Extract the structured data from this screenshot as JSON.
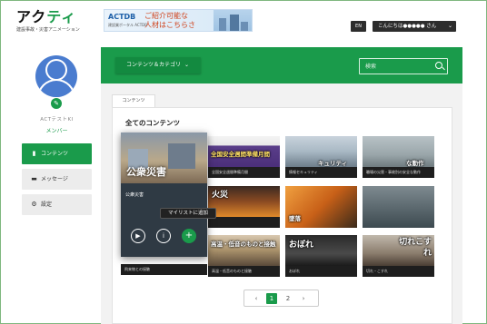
{
  "header": {
    "logo_prefix": "アク",
    "logo_accent": "ティ",
    "logo_sub": "建設事故・災害アニメーション",
    "banner": {
      "brand": "ACTDB",
      "brand_sub": "建設業ポータル ACTDB",
      "line1": "ご紹介可能な",
      "line2": "人材はこちらさ"
    },
    "lang_label": "EN",
    "greeting": "こんにちは●●●●● さん"
  },
  "sidebar": {
    "user_name": "ACTテストKI",
    "role": "メンバー",
    "items": [
      {
        "label": "コンテンツ",
        "icon": "book-icon",
        "active": true
      },
      {
        "label": "メッセージ",
        "icon": "chat-icon",
        "active": false
      },
      {
        "label": "設定",
        "icon": "gear-icon",
        "active": false
      }
    ]
  },
  "toolbar": {
    "category_label": "コンテンツ＆カテゴリ",
    "search_placeholder": "検索"
  },
  "tab_label": "コンテンツ",
  "section_title": "全てのコンテンツ",
  "overlay": {
    "title": "公衆災害",
    "subtitle": "公衆災害",
    "tooltip": "マイリストに追加"
  },
  "thumbs": [
    {
      "caption": "",
      "big": ""
    },
    {
      "caption": "全国安全週間準備月間",
      "big": "全国安全週間準備月間"
    },
    {
      "caption": "情報セキュリティ",
      "big": "キュリティ"
    },
    {
      "caption": "職場の災害・事故別の安全な動作",
      "big": "な動作"
    },
    {
      "caption": "",
      "big": "火災"
    },
    {
      "caption": "墜落",
      "big": "墜落"
    },
    {
      "caption": "",
      "big": ""
    },
    {
      "caption": "飛来物との接触",
      "big": ""
    },
    {
      "caption": "高温・低音のものと接触",
      "big": "高温・低音のものと接触"
    },
    {
      "caption": "おぼれ",
      "big": "おぼれ"
    },
    {
      "caption": "切れ・こすれ",
      "big": "切れこすれ"
    }
  ],
  "pagination": {
    "prev": "‹",
    "pages": [
      "1",
      "2"
    ],
    "next": "›"
  }
}
